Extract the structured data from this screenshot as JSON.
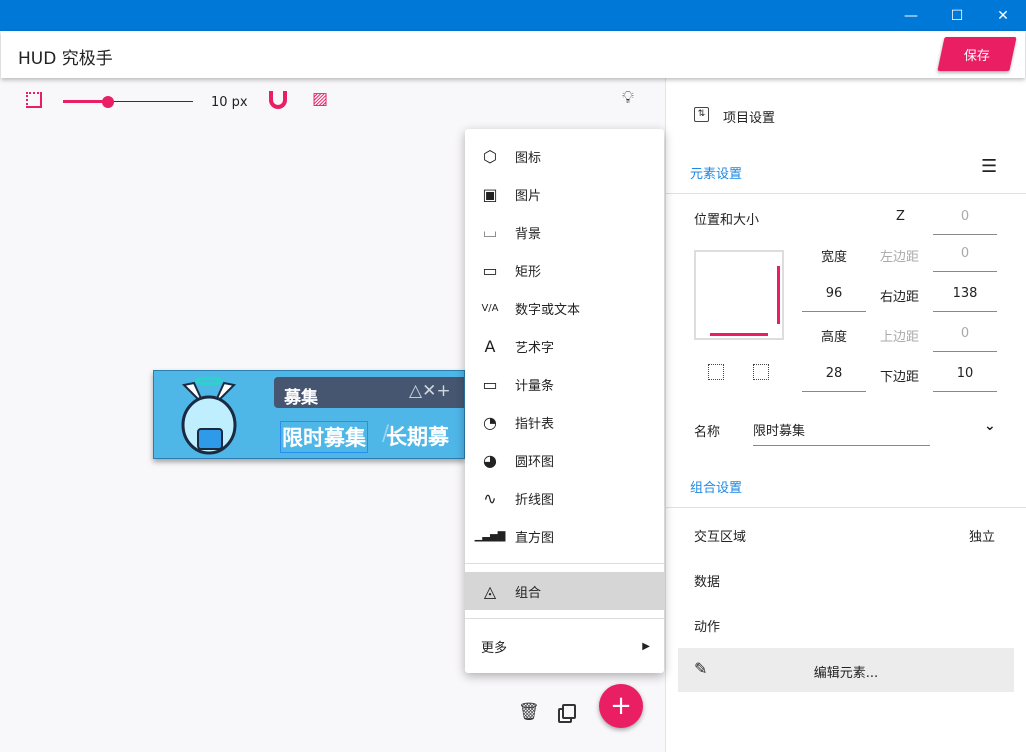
{
  "window": {
    "minimize": "—",
    "maximize": "☐",
    "close": "✕"
  },
  "header": {
    "title": "HUD 究极手",
    "save_label": "保存"
  },
  "toolbar": {
    "grid_size": "10 px",
    "grid_value": 10
  },
  "canvas": {
    "hud_title": "募集",
    "hud_symbols": "△✕+",
    "hud_tab1": "限时募集",
    "hud_sep": "/",
    "hud_tab2": "长期募"
  },
  "menu": {
    "items": [
      {
        "icon": "hexagon-icon",
        "glyph": "⬡",
        "label": "图标"
      },
      {
        "icon": "image-icon",
        "glyph": "▣",
        "label": "图片"
      },
      {
        "icon": "background-icon",
        "glyph": "⌴",
        "label": "背景"
      },
      {
        "icon": "rectangle-icon",
        "glyph": "▭",
        "label": "矩形"
      },
      {
        "icon": "text-number-icon",
        "glyph": "V/A",
        "label": "数字或文本"
      },
      {
        "icon": "art-text-icon",
        "glyph": "A",
        "label": "艺术字"
      },
      {
        "icon": "gauge-bar-icon",
        "glyph": "▭",
        "label": "计量条"
      },
      {
        "icon": "dial-icon",
        "glyph": "◔",
        "label": "指针表"
      },
      {
        "icon": "pie-chart-icon",
        "glyph": "◕",
        "label": "圆环图"
      },
      {
        "icon": "line-chart-icon",
        "glyph": "∿",
        "label": "折线图"
      },
      {
        "icon": "bar-chart-icon",
        "glyph": "▁▃▅▇",
        "label": "直方图"
      }
    ],
    "group_label": "组合",
    "more_label": "更多"
  },
  "panel": {
    "project_settings": "项目设置",
    "element_settings": "元素设置",
    "pos_size": "位置和大小",
    "z_label": "Z",
    "z_value": "0",
    "width_label": "宽度",
    "width_value": "96",
    "height_label": "高度",
    "height_value": "28",
    "left_label": "左边距",
    "left_value": "0",
    "right_label": "右边距",
    "right_value": "138",
    "top_label": "上边距",
    "top_value": "0",
    "bottom_label": "下边距",
    "bottom_value": "10",
    "name_label": "名称",
    "name_value": "限时募集",
    "group_settings": "组合设置",
    "interaction_label": "交互区域",
    "interaction_value": "独立",
    "data_label": "数据",
    "action_label": "动作",
    "edit_label": "编辑元素..."
  }
}
